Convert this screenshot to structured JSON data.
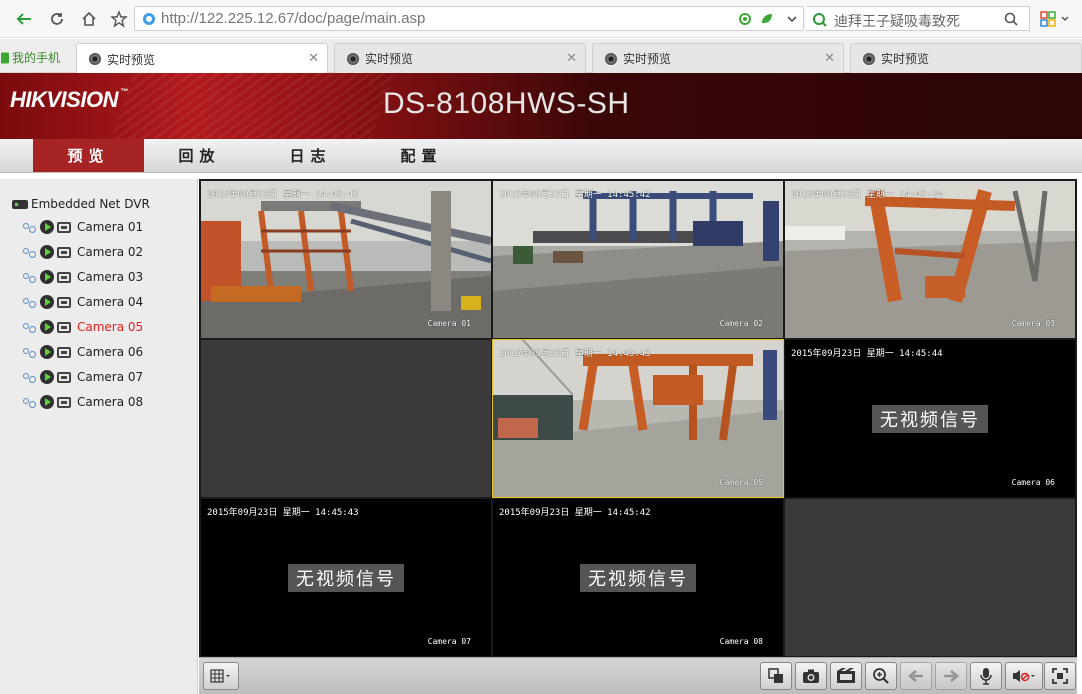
{
  "browser": {
    "url_host": "http://122.225.12.67",
    "url_path": "/doc/page/main.asp",
    "search_text": "迪拜王子疑吸毒致死",
    "fav_label": "我的手机",
    "tabs": [
      {
        "label": "实时预览",
        "active": true
      },
      {
        "label": "实时预览",
        "active": false
      },
      {
        "label": "实时预览",
        "active": false
      },
      {
        "label": "实时预览",
        "active": false
      }
    ]
  },
  "header": {
    "logo": "HIKVISION",
    "model": "DS-8108HWS-SH"
  },
  "menu": [
    {
      "label": "预览",
      "active": true
    },
    {
      "label": "回放",
      "active": false
    },
    {
      "label": "日志",
      "active": false
    },
    {
      "label": "配置",
      "active": false
    }
  ],
  "tree": {
    "root": "Embedded Net DVR",
    "cameras": [
      {
        "label": "Camera 01",
        "selected": false
      },
      {
        "label": "Camera 02",
        "selected": false
      },
      {
        "label": "Camera 03",
        "selected": false
      },
      {
        "label": "Camera 04",
        "selected": false
      },
      {
        "label": "Camera 05",
        "selected": true
      },
      {
        "label": "Camera 06",
        "selected": false
      },
      {
        "label": "Camera 07",
        "selected": false
      },
      {
        "label": "Camera 08",
        "selected": false
      }
    ]
  },
  "grid": {
    "cells": [
      {
        "osd": "2015年09月23日 星期一 14:45:42",
        "camera": "Camera 01",
        "state": "video"
      },
      {
        "osd": "2015年09月23日 星期一 14:45:42",
        "camera": "Camera 02",
        "state": "video"
      },
      {
        "osd": "2015年09月23日 星期一 14:45:24",
        "camera": "Camera 03",
        "state": "video"
      },
      {
        "osd": "",
        "camera": "",
        "state": "empty"
      },
      {
        "osd": "2015年09月23日 星期一 14:45:43",
        "camera": "Camera 05",
        "state": "video"
      },
      {
        "osd": "2015年09月23日 星期一 14:45:44",
        "camera": "Camera 06",
        "state": "nosignal"
      },
      {
        "osd": "2015年09月23日 星期一 14:45:43",
        "camera": "Camera 07",
        "state": "nosignal"
      },
      {
        "osd": "2015年09月23日 星期一 14:45:42",
        "camera": "Camera 08",
        "state": "nosignal"
      },
      {
        "osd": "",
        "camera": "",
        "state": "empty"
      }
    ],
    "no_signal_text": "无视频信号"
  },
  "controls": {
    "icons": [
      "layout-icon",
      "stop-all-icon",
      "capture-icon",
      "record-icon",
      "zoom-icon",
      "prev-page-icon",
      "next-page-icon",
      "microphone-icon",
      "volume-icon",
      "fullscreen-icon"
    ]
  }
}
